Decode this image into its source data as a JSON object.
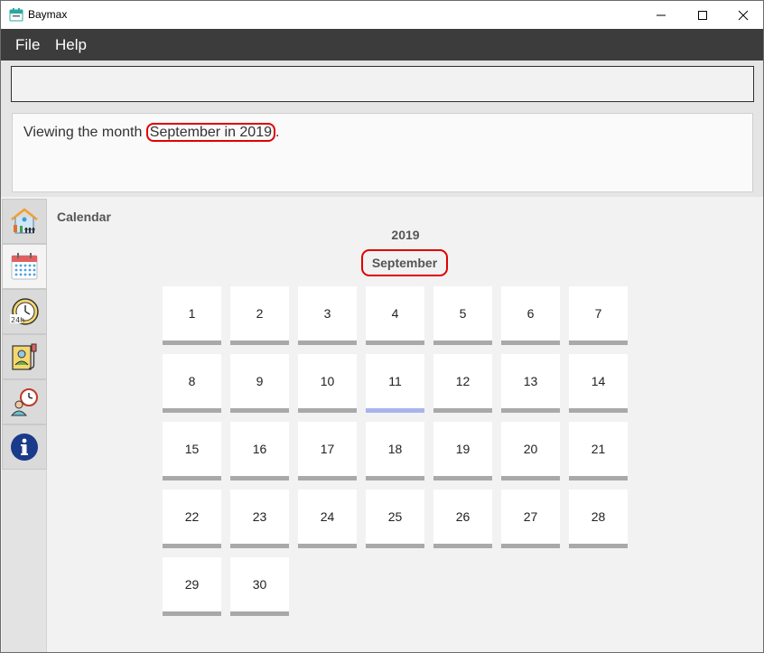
{
  "window": {
    "title": "Baymax"
  },
  "menu": {
    "file": "File",
    "help": "Help"
  },
  "command": {
    "value": "",
    "placeholder": ""
  },
  "result": {
    "prefix": "Viewing the month ",
    "highlight": "September in 2019",
    "suffix": "."
  },
  "tabs": [
    {
      "name": "home",
      "icon": "home-icon"
    },
    {
      "name": "calendar",
      "icon": "calendar-icon",
      "active": true
    },
    {
      "name": "schedule",
      "icon": "24-hour-clock-icon"
    },
    {
      "name": "patients",
      "icon": "patient-record-icon"
    },
    {
      "name": "appointments",
      "icon": "doctor-clock-icon"
    },
    {
      "name": "info",
      "icon": "info-icon"
    }
  ],
  "calendar": {
    "label": "Calendar",
    "year": "2019",
    "month": "September",
    "today": "11",
    "days": [
      "1",
      "2",
      "3",
      "4",
      "5",
      "6",
      "7",
      "8",
      "9",
      "10",
      "11",
      "12",
      "13",
      "14",
      "15",
      "16",
      "17",
      "18",
      "19",
      "20",
      "21",
      "22",
      "23",
      "24",
      "25",
      "26",
      "27",
      "28",
      "29",
      "30"
    ]
  },
  "colors": {
    "accent_red": "#e00000",
    "today_underline": "#a8b4f0",
    "menubar": "#3c3c3c"
  }
}
